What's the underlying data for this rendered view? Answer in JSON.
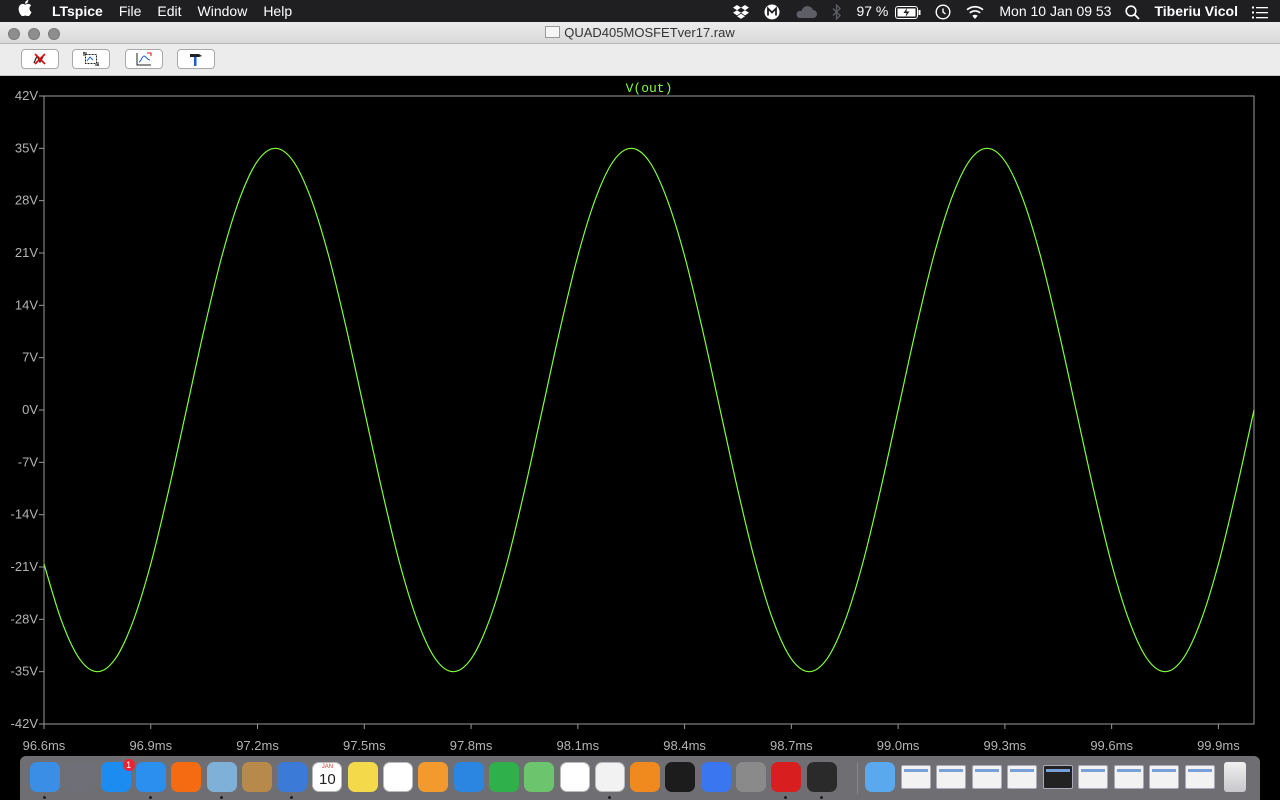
{
  "menubar": {
    "apple_icon": "apple-logo-icon",
    "app_name": "LTspice",
    "menus": [
      "File",
      "Edit",
      "Window",
      "Help"
    ],
    "battery": "97 %",
    "datetime": "Mon 10 Jan  09 53",
    "user": "Tiberiu Vicol",
    "status_icons": [
      "dropbox-icon",
      "m-icon",
      "cloud-icon",
      "bluetooth-icon",
      "battery-icon",
      "time-machine-icon",
      "wifi-icon",
      "search-icon",
      "list-icon"
    ]
  },
  "window": {
    "title": "QUAD405MOSFETver17.raw"
  },
  "toolbar": {
    "buttons": [
      "close-trace-icon",
      "zoom-rect-icon",
      "autorange-icon",
      "hammer-icon"
    ]
  },
  "chart_data": {
    "type": "line",
    "title": "",
    "trace_label": "V(out)",
    "series": [
      {
        "name": "V(out)",
        "color": "#7fff3a",
        "x_ms": [
          96.6,
          96.65,
          96.7,
          96.75,
          96.8,
          96.85,
          96.9,
          96.95,
          97.0,
          97.05,
          97.1,
          97.15,
          97.2,
          97.25,
          97.3,
          97.35,
          97.4,
          97.45,
          97.5,
          97.55,
          97.6,
          97.65,
          97.7,
          97.75,
          97.8,
          97.85,
          97.9,
          97.95,
          98.0,
          98.05,
          98.1,
          98.15,
          98.2,
          98.25,
          98.3,
          98.35,
          98.4,
          98.45,
          98.5,
          98.55,
          98.6,
          98.65,
          98.7,
          98.75,
          98.8,
          98.85,
          98.9,
          98.95,
          99.0,
          99.05,
          99.1,
          99.15,
          99.2,
          99.25,
          99.3,
          99.35,
          99.4,
          99.45,
          99.5,
          99.55,
          99.6,
          99.65,
          99.7,
          99.75,
          99.8,
          99.85,
          99.9,
          99.95,
          100.0
        ],
        "y_V": [
          -20.6,
          -28.3,
          -33.3,
          -35.0,
          -33.3,
          -28.3,
          -20.6,
          -10.8,
          0.0,
          10.8,
          20.6,
          28.3,
          33.3,
          35.0,
          33.3,
          28.3,
          20.6,
          10.8,
          0.0,
          -10.8,
          -20.6,
          -28.3,
          -33.3,
          -35.0,
          -33.3,
          -28.3,
          -20.6,
          -10.8,
          0.0,
          10.8,
          20.6,
          28.3,
          33.3,
          35.0,
          33.3,
          28.3,
          20.6,
          10.8,
          0.0,
          -10.8,
          -20.6,
          -28.3,
          -33.3,
          -35.0,
          -33.3,
          -28.3,
          -20.6,
          -10.8,
          0.0,
          10.8,
          20.6,
          28.3,
          33.3,
          35.0,
          33.3,
          28.3,
          20.6,
          10.8,
          0.0,
          -10.8,
          -20.6,
          -28.3,
          -33.3,
          -35.0,
          -33.3,
          -28.3,
          -20.6,
          -10.8,
          0.0
        ]
      }
    ],
    "xlim_ms": [
      96.6,
      100.0
    ],
    "ylim_V": [
      -42,
      42
    ],
    "x_ticks": [
      "96.6ms",
      "96.9ms",
      "97.2ms",
      "97.5ms",
      "97.8ms",
      "98.1ms",
      "98.4ms",
      "98.7ms",
      "99.0ms",
      "99.3ms",
      "99.6ms",
      "99.9ms"
    ],
    "x_tick_values_ms": [
      96.6,
      96.9,
      97.2,
      97.5,
      97.8,
      98.1,
      98.4,
      98.7,
      99.0,
      99.3,
      99.6,
      99.9
    ],
    "y_ticks": [
      "42V",
      "35V",
      "28V",
      "21V",
      "14V",
      "7V",
      "0V",
      "-7V",
      "-14V",
      "-21V",
      "-28V",
      "-35V",
      "-42V"
    ],
    "y_tick_values_V": [
      42,
      35,
      28,
      21,
      14,
      7,
      0,
      -7,
      -14,
      -21,
      -28,
      -35,
      -42
    ],
    "grid": false,
    "colors": {
      "background": "#000000",
      "axis": "#9a9a9a",
      "tick_text": "#b4b4b4",
      "trace": "#7fff3a"
    }
  },
  "dock": {
    "apps": [
      "finder-icon",
      "launchpad-icon",
      "app-store-icon",
      "safari-icon",
      "firefox-icon",
      "preview-icon",
      "notes-brown-icon",
      "xcode-icon",
      "calendar-icon",
      "stickies-icon",
      "textedit-icon",
      "pages-icon",
      "keynote-icon",
      "numbers-icon",
      "maps-icon",
      "photos-icon",
      "music-icon",
      "books-icon",
      "terminal-icon",
      "signal-icon",
      "calculator-icon",
      "acrobat-icon",
      "ltspice-icon"
    ],
    "calendar_month": "JAN",
    "calendar_day": "10",
    "app_store_badge": "1",
    "windows": [
      "downloads-folder-icon",
      "minimized-window-1",
      "minimized-window-2",
      "minimized-window-3",
      "minimized-window-4",
      "minimized-window-5",
      "minimized-window-6",
      "minimized-window-7",
      "minimized-window-8",
      "minimized-window-9",
      "trash-icon"
    ]
  }
}
